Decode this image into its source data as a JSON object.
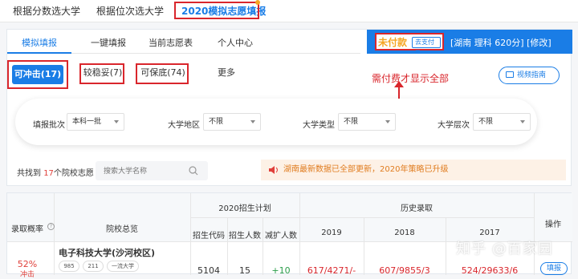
{
  "topnav": {
    "items": [
      "根据分数选大学",
      "根据位次选大学",
      "2020模拟志愿填报"
    ]
  },
  "tabs": [
    "模拟填报",
    "一键填报",
    "当前志愿表",
    "个人中心"
  ],
  "status": {
    "unpaid": "未付款",
    "pay_button": "去支付",
    "profile": "[湖南  理科  620分] [修改]"
  },
  "annotation": "需付费才显示全部",
  "filters": {
    "chong": "可冲击(17)",
    "wen": "较稳妥(7)",
    "bao": "可保底(74)",
    "more": "更多"
  },
  "video_guide": "视频指南",
  "selects": [
    {
      "label": "填报批次",
      "value": "本科一批"
    },
    {
      "label": "大学地区",
      "value": "不限"
    },
    {
      "label": "大学类型",
      "value": "不限"
    },
    {
      "label": "大学层次",
      "value": "不限"
    }
  ],
  "found": {
    "prefix": "共找到",
    "count": "17",
    "suffix": "个院校志愿"
  },
  "search_placeholder": "搜索大学名称",
  "notice": "湖南最新数据已全部更新，2020年策略已升级",
  "table": {
    "headers": {
      "prob": "录取概率",
      "overview": "院校总览",
      "plan": "2020招生计划",
      "history": "历史录取",
      "op": "操作"
    },
    "sub_headers": [
      "招生代码",
      "招生人数",
      "减扩人数",
      "2019",
      "2018",
      "2017"
    ],
    "row": {
      "prob": "52%",
      "prob_label": "冲击",
      "school": "电子科技大学(沙河校区)",
      "tags": [
        "985",
        "211",
        "一流大学"
      ],
      "code": "5104",
      "count": "15",
      "delta": "+10",
      "y2019": "617/4271/-",
      "y2018": "607/9855/3",
      "y2017": "524/29633/6",
      "op": "填报"
    }
  },
  "watermark": "知乎 @百家园",
  "colors": {
    "accent": "#1a7de6",
    "annotation_red": "#d9262c",
    "unpaid_orange": "#f5a623",
    "prob_red": "#e0403b",
    "delta_green": "#2a9d4a"
  }
}
